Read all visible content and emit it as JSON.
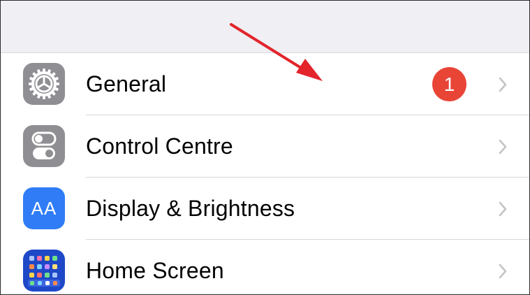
{
  "settings": {
    "items": [
      {
        "label": "General",
        "icon": "gear-icon",
        "badge": "1"
      },
      {
        "label": "Control Centre",
        "icon": "toggles-icon"
      },
      {
        "label": "Display & Brightness",
        "icon": "text-size-icon",
        "icon_text": "AA"
      },
      {
        "label": "Home Screen",
        "icon": "home-screen-grid-icon"
      }
    ]
  },
  "colors": {
    "background": "#efeff4",
    "row_background": "#ffffff",
    "badge": "#e84537",
    "gray_icon": "#8e8e93",
    "display_icon": "#2f7cf6",
    "home_icon": "#1e48c7",
    "annotation_arrow": "#e3242b",
    "chevron": "#c4c4c7"
  }
}
